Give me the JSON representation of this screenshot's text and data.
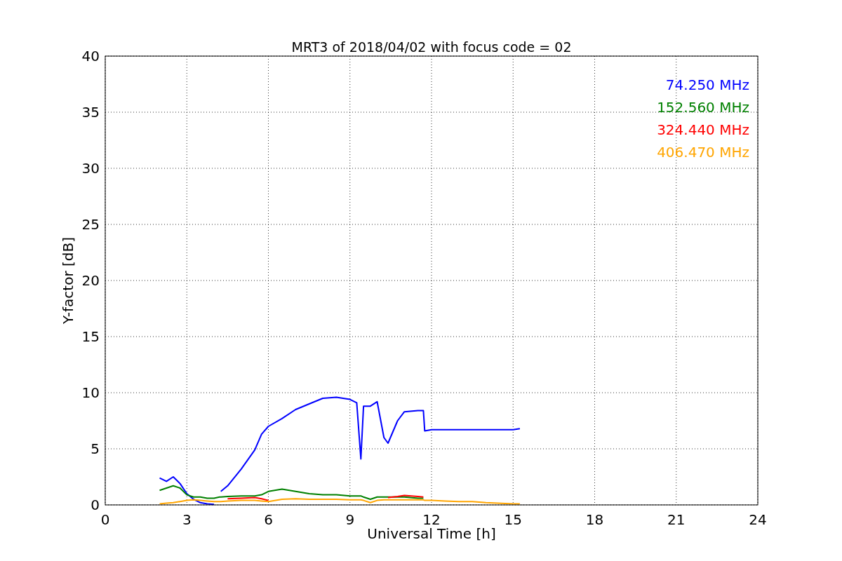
{
  "chart_data": {
    "type": "line",
    "title": "MRT3 of 2018/04/02 with focus code = 02",
    "xlabel": "Universal Time [h]",
    "ylabel": "Y-factor [dB]",
    "x": [
      2.0,
      2.25,
      2.5,
      2.75,
      3.0,
      3.25,
      3.5,
      3.75,
      4.0,
      4.2,
      4.25,
      4.5,
      5.0,
      5.5,
      5.75,
      6.0,
      6.5,
      7.0,
      7.5,
      8.0,
      8.5,
      9.0,
      9.25,
      9.4,
      9.5,
      9.75,
      10.0,
      10.25,
      10.4,
      10.75,
      11.0,
      11.5,
      11.7,
      11.75,
      12.0,
      12.5,
      13.0,
      13.5,
      14.0,
      15.0,
      15.25
    ],
    "series": [
      {
        "name": "74.250 MHz",
        "color": "#0000ff",
        "values": [
          2.4,
          2.1,
          2.5,
          1.9,
          1.0,
          0.5,
          0.2,
          0.1,
          0.05,
          null,
          1.2,
          1.7,
          3.2,
          4.9,
          6.3,
          7.0,
          7.7,
          8.5,
          9.0,
          9.5,
          9.6,
          9.4,
          9.1,
          4.1,
          8.8,
          8.8,
          9.2,
          6.0,
          5.5,
          7.5,
          8.3,
          8.4,
          8.4,
          6.6,
          6.7,
          6.7,
          6.7,
          6.7,
          6.7,
          6.7,
          6.8
        ]
      },
      {
        "name": "152.560 MHz",
        "color": "#008000",
        "values": [
          1.3,
          1.5,
          1.7,
          1.5,
          0.9,
          0.7,
          0.7,
          0.6,
          0.6,
          0.7,
          0.7,
          0.75,
          0.8,
          0.8,
          0.9,
          1.2,
          1.4,
          1.2,
          1.0,
          0.9,
          0.9,
          0.8,
          0.8,
          0.8,
          0.7,
          0.5,
          0.7,
          0.7,
          0.7,
          0.7,
          0.7,
          0.6,
          0.6,
          null,
          null,
          null,
          null,
          null,
          null,
          null,
          null
        ]
      },
      {
        "name": "324.440 MHz",
        "color": "#ff0000",
        "values": [
          null,
          null,
          null,
          null,
          null,
          null,
          null,
          null,
          null,
          null,
          null,
          0.55,
          0.6,
          0.65,
          0.55,
          0.4,
          null,
          null,
          null,
          null,
          null,
          null,
          null,
          null,
          null,
          null,
          null,
          null,
          0.65,
          0.75,
          0.85,
          0.75,
          0.7,
          null,
          null,
          null,
          null,
          null,
          null,
          null,
          null
        ]
      },
      {
        "name": "406.470 MHz",
        "color": "#ffa500",
        "values": [
          0.1,
          0.15,
          0.2,
          0.3,
          0.4,
          0.45,
          0.4,
          0.35,
          0.3,
          0.3,
          0.3,
          0.35,
          0.4,
          0.4,
          0.35,
          0.3,
          0.5,
          0.55,
          0.5,
          0.5,
          0.5,
          0.45,
          0.45,
          0.45,
          0.4,
          0.2,
          0.4,
          0.45,
          0.45,
          0.45,
          0.45,
          0.45,
          0.45,
          0.4,
          0.4,
          0.35,
          0.3,
          0.3,
          0.2,
          0.1,
          0.1
        ]
      }
    ],
    "xlim": [
      0,
      24
    ],
    "ylim": [
      0,
      40
    ],
    "xticks": [
      0,
      3,
      6,
      9,
      12,
      15,
      18,
      21,
      24
    ],
    "yticks": [
      0,
      5,
      10,
      15,
      20,
      25,
      30,
      35,
      40
    ],
    "grid": true
  }
}
